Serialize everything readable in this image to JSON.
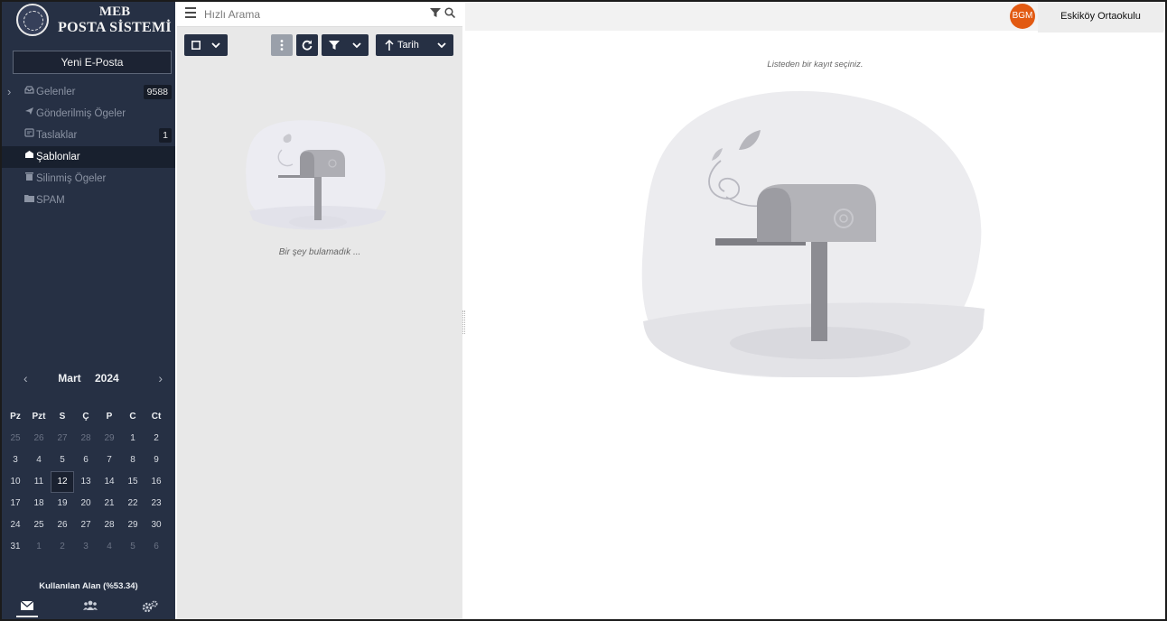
{
  "sidebar": {
    "logo": {
      "line1": "MEB",
      "line2": "POSTA SİSTEMİ",
      "icon": "ministry-seal-icon"
    },
    "new_mail_label": "Yeni E-Posta",
    "folders": [
      {
        "label": "Gelenler",
        "icon": "inbox-icon",
        "badge": "9588",
        "expandable": true
      },
      {
        "label": "Gönderilmiş Ögeler",
        "icon": "paper-plane-icon"
      },
      {
        "label": "Taslaklar",
        "icon": "draft-icon",
        "badge": "1"
      },
      {
        "label": "Şablonlar",
        "icon": "template-icon",
        "active": true
      },
      {
        "label": "Silinmiş Ögeler",
        "icon": "trash-icon"
      },
      {
        "label": "SPAM",
        "icon": "folder-icon"
      }
    ],
    "calendar": {
      "month": "Mart",
      "year": "2024",
      "weekdays": [
        "Pz",
        "Pzt",
        "S",
        "Ç",
        "P",
        "C",
        "Ct"
      ],
      "weeks": [
        [
          "25",
          "26",
          "27",
          "28",
          "29",
          "1",
          "2"
        ],
        [
          "3",
          "4",
          "5",
          "6",
          "7",
          "8",
          "9"
        ],
        [
          "10",
          "11",
          "12",
          "13",
          "14",
          "15",
          "16"
        ],
        [
          "17",
          "18",
          "19",
          "20",
          "21",
          "22",
          "23"
        ],
        [
          "24",
          "25",
          "26",
          "27",
          "28",
          "29",
          "30"
        ],
        [
          "31",
          "1",
          "2",
          "3",
          "4",
          "5",
          "6"
        ]
      ],
      "today": "12"
    },
    "usage_label": "Kullanılan Alan (%53.34)",
    "bottom_tabs": [
      "mail-icon",
      "users-icon",
      "settings-icon"
    ]
  },
  "list": {
    "search_placeholder": "Hızlı Arama",
    "sort_label": "Tarih",
    "empty_text": "Bir şey bulamadık ..."
  },
  "reading": {
    "select_prompt": "Listeden bir kayıt seçiniz."
  },
  "header": {
    "avatar_initials": "BGM",
    "school": "Eskiköy Ortaokulu"
  },
  "colors": {
    "sidebar_bg": "#263044",
    "avatar_bg": "#e25a12",
    "list_bg": "#e8e8e8"
  }
}
